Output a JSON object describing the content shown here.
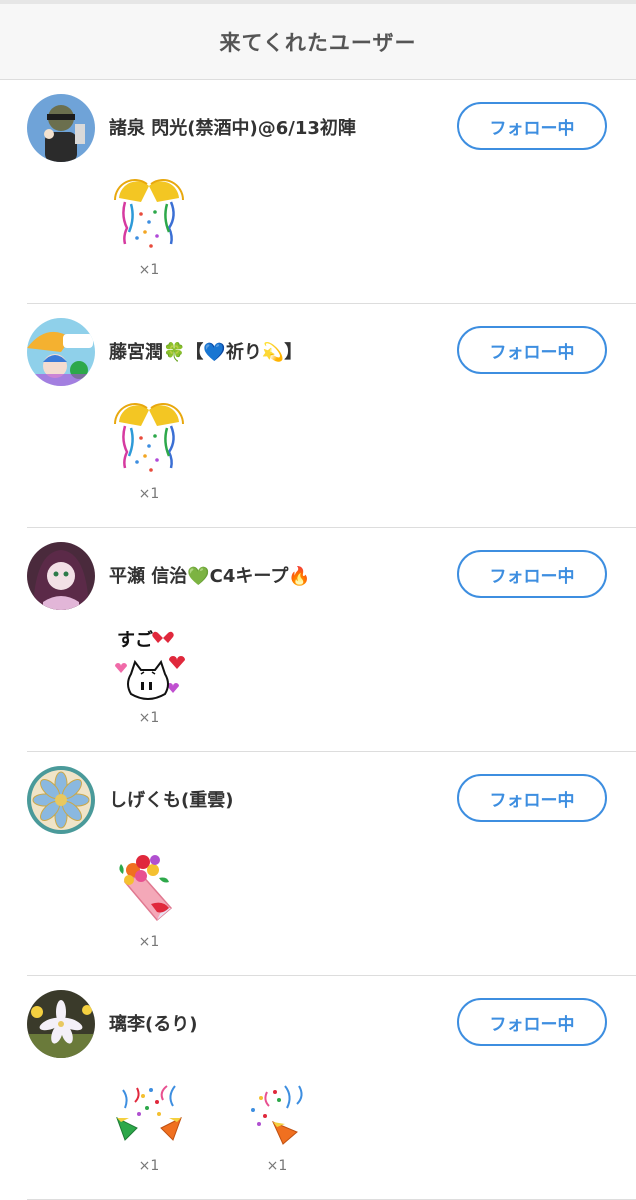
{
  "header": {
    "title": "来てくれたユーザー"
  },
  "users": [
    {
      "name": "諸泉 閃光(禁酒中)@6/13初陣",
      "follow_label": "フォロー中",
      "gifts": [
        {
          "icon": "kusudama-icon",
          "count": "×1"
        }
      ]
    },
    {
      "name": "藤宮潤🍀【💙祈り💫】",
      "follow_label": "フォロー中",
      "gifts": [
        {
          "icon": "kusudama-icon",
          "count": "×1"
        }
      ]
    },
    {
      "name": "平瀬 信治💚C4キープ🔥",
      "follow_label": "フォロー中",
      "gifts": [
        {
          "icon": "sugoi-cat-icon",
          "count": "×1"
        }
      ]
    },
    {
      "name": "しげくも(重雲)",
      "follow_label": "フォロー中",
      "gifts": [
        {
          "icon": "bouquet-icon",
          "count": "×1"
        }
      ]
    },
    {
      "name": "璃李(るり)",
      "follow_label": "フォロー中",
      "gifts": [
        {
          "icon": "party-popper-icon",
          "count": "×1"
        },
        {
          "icon": "party-popper-icon",
          "count": "×1"
        }
      ]
    }
  ],
  "colors": {
    "accent": "#3d8ee0",
    "text": "#333333",
    "divider": "#dddddd"
  }
}
